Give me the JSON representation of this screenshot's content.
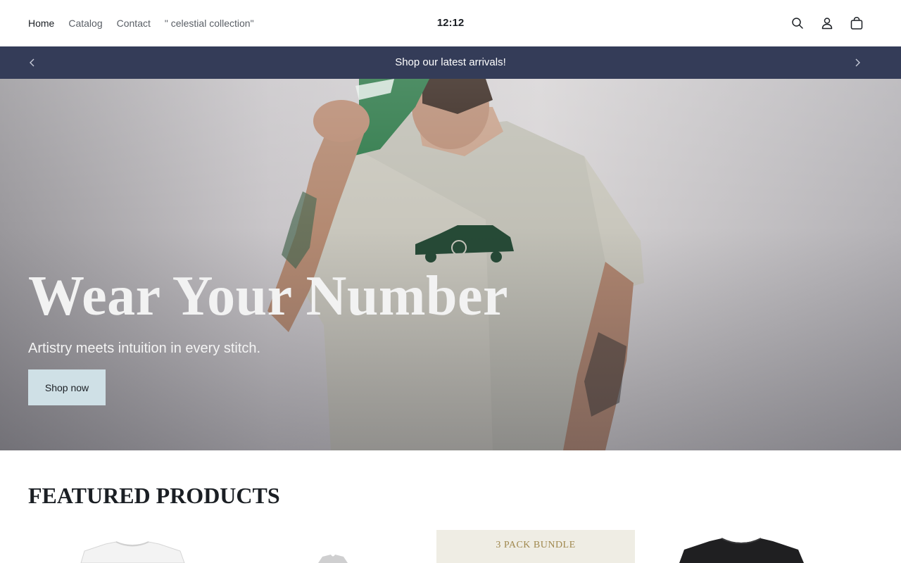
{
  "header": {
    "nav": [
      "Home",
      "Catalog",
      "Contact",
      "\" celestial collection\""
    ],
    "active_nav": "Home",
    "logo": "12:12",
    "icons": [
      "search-icon",
      "account-icon",
      "cart-icon"
    ]
  },
  "announcement": {
    "text": "Shop our latest arrivals!",
    "prev_icon": "chevron-left-icon",
    "next_icon": "chevron-right-icon"
  },
  "hero": {
    "title": "Wear Your Number",
    "subtitle": "Artistry meets intuition in every stitch.",
    "button": "Shop now"
  },
  "featured": {
    "title": "FEATURED PRODUCTS",
    "products": [
      {
        "image": "white-tshirt"
      },
      {
        "image": "grey-tshirt"
      },
      {
        "image": "3-pack-bundle",
        "label": "3 PACK BUNDLE"
      },
      {
        "image": "black-tshirt"
      }
    ]
  },
  "colors": {
    "announcement_bg": "#343c58",
    "hero_button_bg": "#cfe0e6",
    "bundle_label": "#a0884e",
    "cap_green": "#2f7a4a"
  }
}
